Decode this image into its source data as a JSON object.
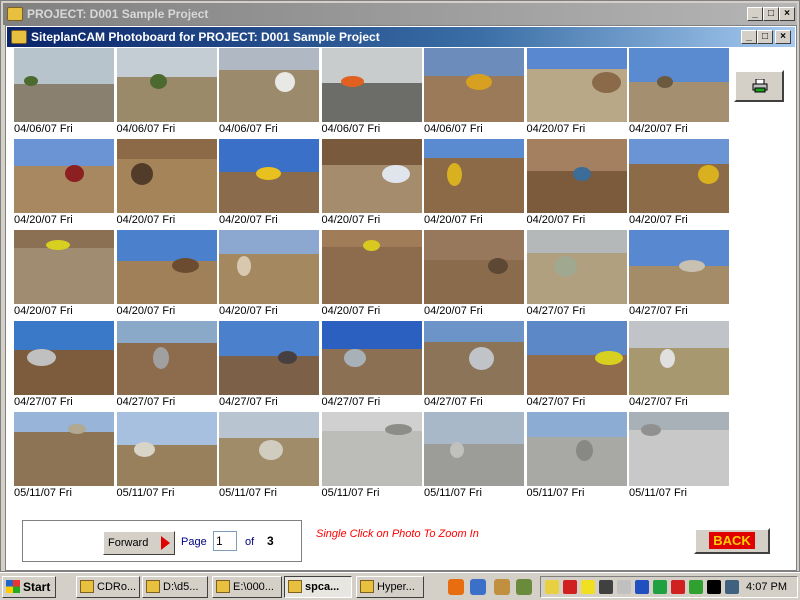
{
  "outer_window": {
    "title": "PROJECT: D001  Sample Project",
    "controls": [
      "_",
      "□",
      "×"
    ]
  },
  "inner_window": {
    "title": "SiteplanCAM Photoboard for PROJECT: D001  Sample Project",
    "controls": [
      "_",
      "□",
      "×"
    ]
  },
  "photos": [
    {
      "date": "04/06/07 Fri",
      "sky": "#b8c4cc",
      "ground": "#8a8070",
      "accent": "#4c6a30"
    },
    {
      "date": "04/06/07 Fri",
      "sky": "#c4ccd4",
      "ground": "#9a8a6a",
      "accent": "#4c6a30"
    },
    {
      "date": "04/06/07 Fri",
      "sky": "#b0b8c4",
      "ground": "#9c8a6c",
      "accent": "#e8e8e4"
    },
    {
      "date": "04/06/07 Fri",
      "sky": "#c8cccc",
      "ground": "#6c6c68",
      "accent": "#e06020"
    },
    {
      "date": "04/06/07 Fri",
      "sky": "#6c8cbc",
      "ground": "#9a7a58",
      "accent": "#d8a020"
    },
    {
      "date": "04/20/07 Fri",
      "sky": "#5a88d0",
      "ground": "#b8a888",
      "accent": "#8a6a48"
    },
    {
      "date": "04/20/07 Fri",
      "sky": "#5a8ad0",
      "ground": "#a49070",
      "accent": "#6c5a40"
    },
    {
      "date": "04/20/07 Fri",
      "sky": "#6a94d4",
      "ground": "#a88860",
      "accent": "#8c2020"
    },
    {
      "date": "04/20/07 Fri",
      "sky": "#8c6a48",
      "ground": "#a48458",
      "accent": "#503c28"
    },
    {
      "date": "04/20/07 Fri",
      "sky": "#3a70c8",
      "ground": "#8a6c4c",
      "accent": "#e8c020"
    },
    {
      "date": "04/20/07 Fri",
      "sky": "#7a5a3c",
      "ground": "#a48c6c",
      "accent": "#e0e4ec"
    },
    {
      "date": "04/20/07 Fri",
      "sky": "#5a8ad0",
      "ground": "#8c6a48",
      "accent": "#d8b020"
    },
    {
      "date": "04/20/07 Fri",
      "sky": "#a48060",
      "ground": "#7c5a3c",
      "accent": "#3c6c98"
    },
    {
      "date": "04/20/07 Fri",
      "sky": "#6a94d4",
      "ground": "#8c6c48",
      "accent": "#d8b020"
    },
    {
      "date": "04/20/07 Fri",
      "sky": "#8c7054",
      "ground": "#a08c70",
      "accent": "#d8d020"
    },
    {
      "date": "04/20/07 Fri",
      "sky": "#4a80cc",
      "ground": "#a08058",
      "accent": "#6c4c30"
    },
    {
      "date": "04/20/07 Fri",
      "sky": "#8ca8d0",
      "ground": "#a48860",
      "accent": "#d8c8b0"
    },
    {
      "date": "04/20/07 Fri",
      "sky": "#a07c58",
      "ground": "#8c6c4c",
      "accent": "#d8c820"
    },
    {
      "date": "04/20/07 Fri",
      "sky": "#98785c",
      "ground": "#8a6c4c",
      "accent": "#5c4834"
    },
    {
      "date": "04/27/07 Fri",
      "sky": "#b4b8b8",
      "ground": "#b0a080",
      "accent": "#a0a890"
    },
    {
      "date": "04/27/07 Fri",
      "sky": "#5888d0",
      "ground": "#a48c68",
      "accent": "#c8c0b0"
    },
    {
      "date": "04/27/07 Fri",
      "sky": "#3a78c8",
      "ground": "#7c5c3c",
      "accent": "#c0c0c0"
    },
    {
      "date": "04/27/07 Fri",
      "sky": "#8aa8c8",
      "ground": "#8c6c4c",
      "accent": "#a0a0a0"
    },
    {
      "date": "04/27/07 Fri",
      "sky": "#4a80cc",
      "ground": "#7c6048",
      "accent": "#484040"
    },
    {
      "date": "04/27/07 Fri",
      "sky": "#2c60c0",
      "ground": "#8c7054",
      "accent": "#a8b0b8"
    },
    {
      "date": "04/27/07 Fri",
      "sky": "#6c94c8",
      "ground": "#8c7458",
      "accent": "#c0c4c8"
    },
    {
      "date": "04/27/07 Fri",
      "sky": "#5c88c8",
      "ground": "#906c4c",
      "accent": "#d8d020"
    },
    {
      "date": "04/27/07 Fri",
      "sky": "#c0c4c8",
      "ground": "#a89870",
      "accent": "#e0e0e0"
    },
    {
      "date": "05/11/07 Fri",
      "sky": "#98b4d8",
      "ground": "#8c7454",
      "accent": "#b0a890"
    },
    {
      "date": "05/11/07 Fri",
      "sky": "#a8c0e0",
      "ground": "#98805c",
      "accent": "#d8d4c8"
    },
    {
      "date": "05/11/07 Fri",
      "sky": "#b8c4d0",
      "ground": "#a08c68",
      "accent": "#d0ccc0"
    },
    {
      "date": "05/11/07 Fri",
      "sky": "#d0d0d0",
      "ground": "#bcbcb8",
      "accent": "#8c8c88"
    },
    {
      "date": "05/11/07 Fri",
      "sky": "#a8b8c8",
      "ground": "#9c9c98",
      "accent": "#c0c0bc"
    },
    {
      "date": "05/11/07 Fri",
      "sky": "#8cacd4",
      "ground": "#a8a8a4",
      "accent": "#888884"
    },
    {
      "date": "05/11/07 Fri",
      "sky": "#a8b0b8",
      "ground": "#c8c8c8",
      "accent": "#909090"
    }
  ],
  "hint": "Single Click on Photo To Zoom In",
  "pager": {
    "forward_label": "Forward",
    "page_label": "Page",
    "page_value": "1",
    "of_label": "of",
    "total_pages": "3"
  },
  "back_label": "BACK",
  "taskbar": {
    "start_label": "Start",
    "tasks": [
      {
        "label": "CDRo...",
        "active": false
      },
      {
        "label": "D:\\d5...",
        "active": false
      },
      {
        "label": "E:\\000...",
        "active": false
      },
      {
        "label": "spca...",
        "active": true
      },
      {
        "label": "Hyper...",
        "active": false
      }
    ],
    "clock": "4:07 PM"
  },
  "colors": {
    "inner_title_start": "#0a246a",
    "back_bg": "#e00000",
    "back_text": "#ffd000",
    "hint": "#ff0000"
  }
}
